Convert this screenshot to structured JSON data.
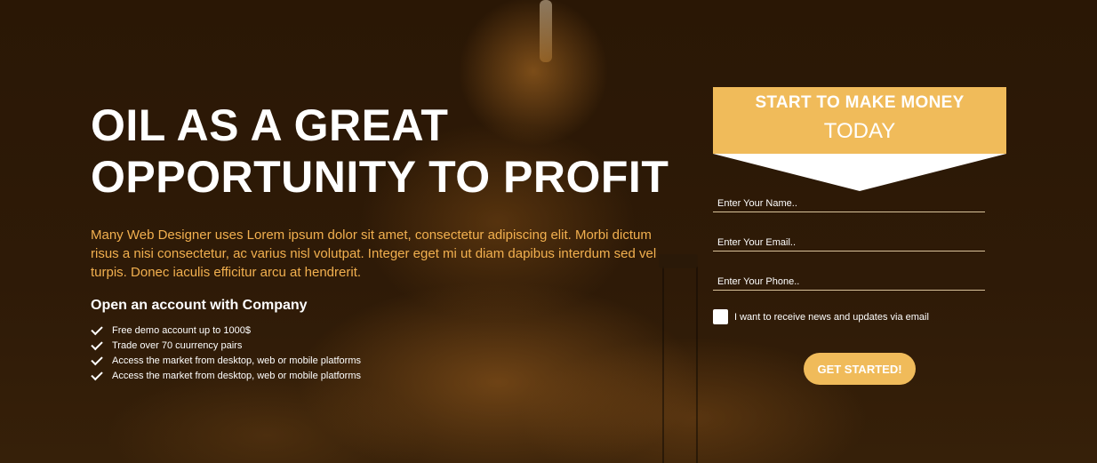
{
  "hero": {
    "headline_line1": "OIL AS A GREAT",
    "headline_line2": "OPPORTUNITY TO PROFIT",
    "description": "Many Web Designer uses Lorem ipsum dolor sit amet, consectetur adipiscing elit. Morbi dictum risus a nisi consectetur, ac varius nisl volutpat. Integer eget mi ut diam dapibus interdum sed vel turpis. Donec iaculis efficitur arcu at hendrerit.",
    "subheading": "Open an account with Company",
    "features": [
      {
        "icon": "check-icon",
        "label": "Free demo account up to 1000$"
      },
      {
        "icon": "check-icon",
        "label": "Trade over 70 cuurrency pairs"
      },
      {
        "icon": "check-icon",
        "label": "Access the market from desktop, web or mobile platforms"
      },
      {
        "icon": "check-icon",
        "label": "Access the market from desktop, web or mobile platforms"
      }
    ]
  },
  "signup": {
    "banner_line1": "START TO MAKE MONEY",
    "banner_line2": "TODAY",
    "name_placeholder": "Enter Your Name..",
    "email_placeholder": "Enter Your Email..",
    "phone_placeholder": "Enter Your Phone..",
    "consent_label": "I want to receive news and updates via email",
    "consent_checked": false,
    "submit_label": "GET STARTED!"
  },
  "colors": {
    "accent": "#f0bb5a",
    "description_text": "#f2b04f",
    "background": "#2b1806"
  }
}
